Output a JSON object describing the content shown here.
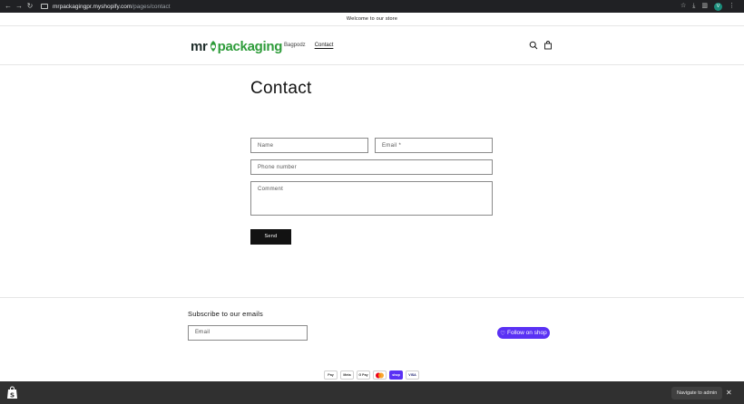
{
  "browser": {
    "url_host": "mrpackagingpr.myshopify.com",
    "url_path": "/pages/contact",
    "profile_initial": "V"
  },
  "announcement": "Welcome to our store",
  "header": {
    "logo_prefix": "mr",
    "logo_suffix": "packaging",
    "nav": [
      {
        "label": "Bagpodz"
      },
      {
        "label": "Contact"
      }
    ]
  },
  "main": {
    "title": "Contact",
    "form": {
      "name_placeholder": "Name",
      "email_placeholder": "Email *",
      "phone_placeholder": "Phone number",
      "comment_placeholder": "Comment",
      "send_label": "Send"
    }
  },
  "footer": {
    "subscribe_title": "Subscribe to our emails",
    "email_placeholder": "Email",
    "follow_label": "Follow on shop",
    "payments": [
      "Pay",
      "Meta",
      "G Pay",
      "",
      "shop",
      "VISA"
    ]
  },
  "admin_bar": {
    "navigate_label": "Navigate to admin"
  },
  "colors": {
    "accent_green": "#2e9c3a",
    "shop_purple": "#5a31f4",
    "button_black": "#121212"
  }
}
